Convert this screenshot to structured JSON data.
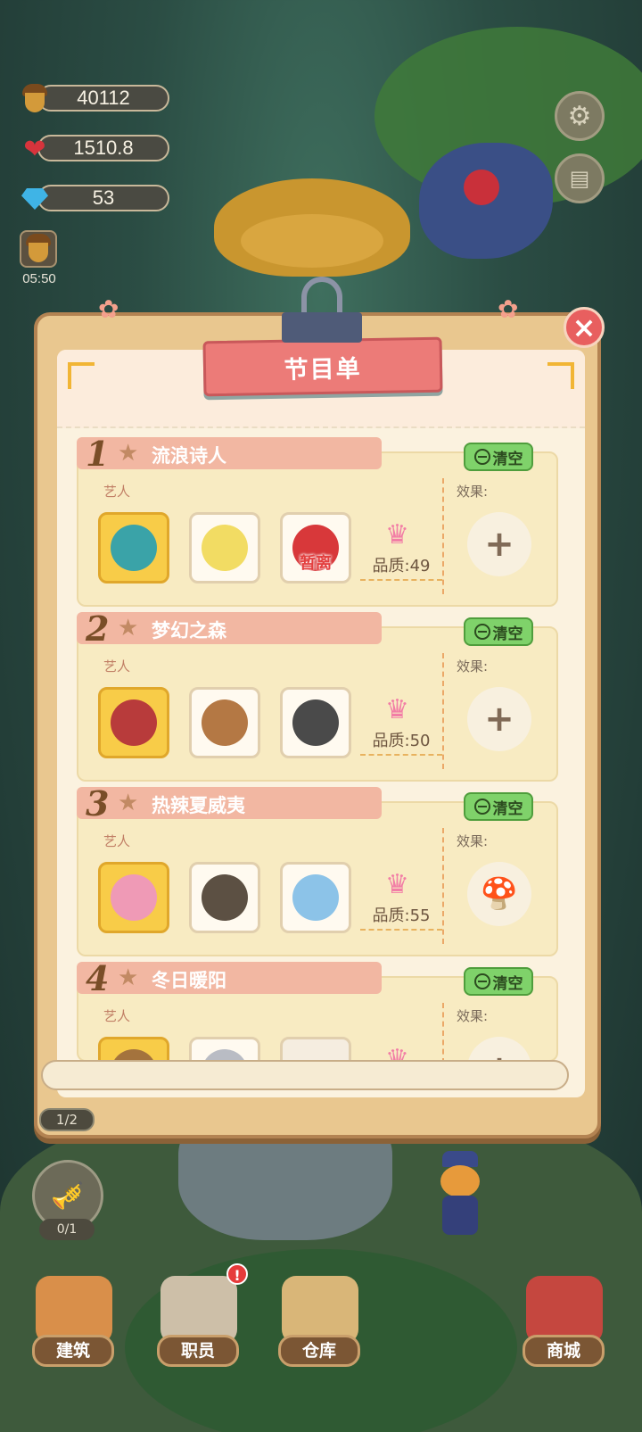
{
  "resources": {
    "acorns": "40112",
    "hearts": "1510.8",
    "gems": "53"
  },
  "timer": "05:50",
  "panel": {
    "title": "节目单",
    "programs": [
      {
        "number": "1",
        "name": "流浪诗人",
        "clear_label": "清空",
        "artists_label": "艺人",
        "effect_label": "效果:",
        "quality_label": "品质:49",
        "artists": [
          {
            "animal": "parrot-cowboy",
            "gold": true,
            "away": ""
          },
          {
            "animal": "cockatiel",
            "gold": false,
            "away": ""
          },
          {
            "animal": "red-parrot",
            "gold": false,
            "away": "暂离"
          }
        ],
        "effect": "add"
      },
      {
        "number": "2",
        "name": "梦幻之森",
        "clear_label": "清空",
        "artists_label": "艺人",
        "effect_label": "效果:",
        "quality_label": "品质:50",
        "artists": [
          {
            "animal": "sheep-hat",
            "gold": true,
            "away": ""
          },
          {
            "animal": "deer",
            "gold": false,
            "away": ""
          },
          {
            "animal": "gorilla",
            "gold": false,
            "away": ""
          }
        ],
        "effect": "add"
      },
      {
        "number": "3",
        "name": "热辣夏威夷",
        "clear_label": "清空",
        "artists_label": "艺人",
        "effect_label": "效果:",
        "quality_label": "品质:55",
        "artists": [
          {
            "animal": "hippo",
            "gold": true,
            "away": ""
          },
          {
            "animal": "bull-cowboy",
            "gold": false,
            "away": ""
          },
          {
            "animal": "elephant",
            "gold": false,
            "away": ""
          }
        ],
        "effect": "rainbow-mushroom"
      },
      {
        "number": "4",
        "name": "冬日暖阳",
        "clear_label": "清空",
        "artists_label": "艺人",
        "effect_label": "效果:",
        "quality_label": "",
        "artists": [
          {
            "animal": "bear-hat",
            "gold": true,
            "away": ""
          },
          {
            "animal": "mouse",
            "gold": false,
            "away": ""
          },
          {
            "animal": "empty",
            "gold": false,
            "away": ""
          }
        ],
        "effect": "add"
      }
    ]
  },
  "page_indicator": "1/2",
  "trumpet_count": "0/1",
  "nav": {
    "build": "建筑",
    "staff": "职员",
    "warehouse": "仓库",
    "shop": "商城",
    "staff_badge": "!"
  },
  "colors": {
    "panel_bg": "#e9c78f",
    "title_ribbon": "#ec7b78",
    "clear_button": "#7fd26a",
    "name_bar": "#f2b7a2",
    "away_text": "#e33f3f"
  }
}
